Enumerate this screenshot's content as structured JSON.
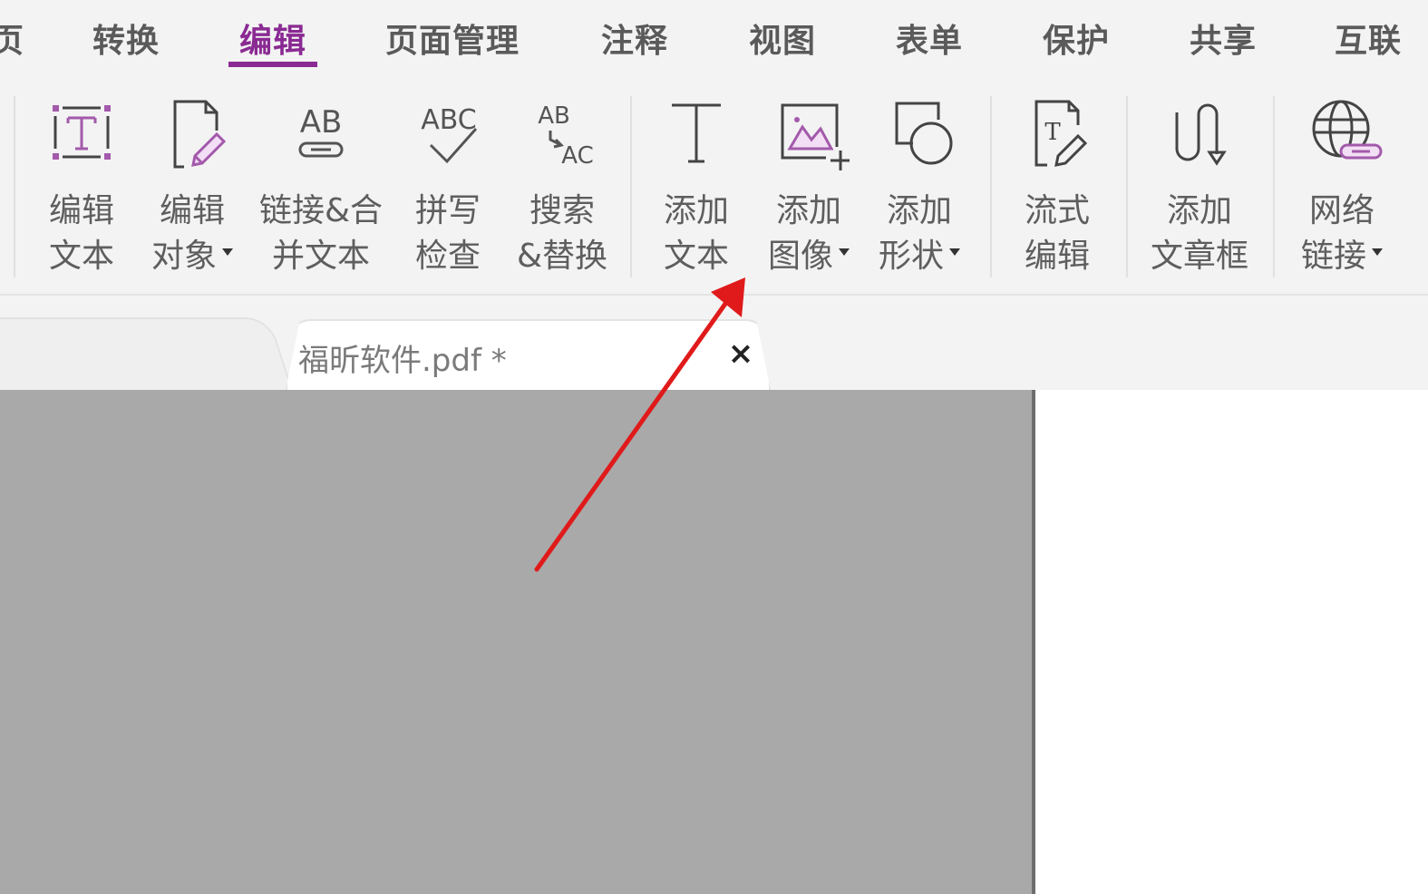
{
  "menu": {
    "tabs": [
      {
        "label": "页",
        "active": false
      },
      {
        "label": "转换",
        "active": false
      },
      {
        "label": "编辑",
        "active": true
      },
      {
        "label": "页面管理",
        "active": false
      },
      {
        "label": "注释",
        "active": false
      },
      {
        "label": "视图",
        "active": false
      },
      {
        "label": "表单",
        "active": false
      },
      {
        "label": "保护",
        "active": false
      },
      {
        "label": "共享",
        "active": false
      },
      {
        "label": "互联",
        "active": false
      }
    ],
    "accent_color": "#8a2a93"
  },
  "ribbon": {
    "buttons": [
      {
        "icon": "edit-text-icon",
        "line1": "编辑",
        "line2": "文本",
        "dropdown": false
      },
      {
        "icon": "edit-object-icon",
        "line1": "编辑",
        "line2": "对象",
        "dropdown": true
      },
      {
        "icon": "link-join-text-icon",
        "line1": "链接&合",
        "line2": "并文本",
        "dropdown": false
      },
      {
        "icon": "spell-check-icon",
        "line1": "拼写",
        "line2": "检查",
        "dropdown": false
      },
      {
        "icon": "search-replace-icon",
        "line1": "搜索",
        "line2": "&替换",
        "dropdown": false
      },
      {
        "icon": "add-text-icon",
        "line1": "添加",
        "line2": "文本",
        "dropdown": false
      },
      {
        "icon": "add-image-icon",
        "line1": "添加",
        "line2": "图像",
        "dropdown": true
      },
      {
        "icon": "add-shape-icon",
        "line1": "添加",
        "line2": "形状",
        "dropdown": true
      },
      {
        "icon": "flow-edit-icon",
        "line1": "流式",
        "line2": "编辑",
        "dropdown": false
      },
      {
        "icon": "add-article-box-icon",
        "line1": "添加",
        "line2": "文章框",
        "dropdown": false
      },
      {
        "icon": "web-link-icon",
        "line1": "网络",
        "line2": "链接",
        "dropdown": true
      }
    ],
    "icon_text": {
      "link_join": "AB",
      "spell_check": "ABC",
      "search_from": "AB",
      "search_to": "AC",
      "flow_edit": "T"
    }
  },
  "document_tabs": [
    {
      "title": "福昕软件.pdf *",
      "close_label": "×",
      "active": true
    }
  ],
  "annotation": {
    "type": "arrow",
    "color": "#e01a1a",
    "points_to": "添加文本"
  }
}
